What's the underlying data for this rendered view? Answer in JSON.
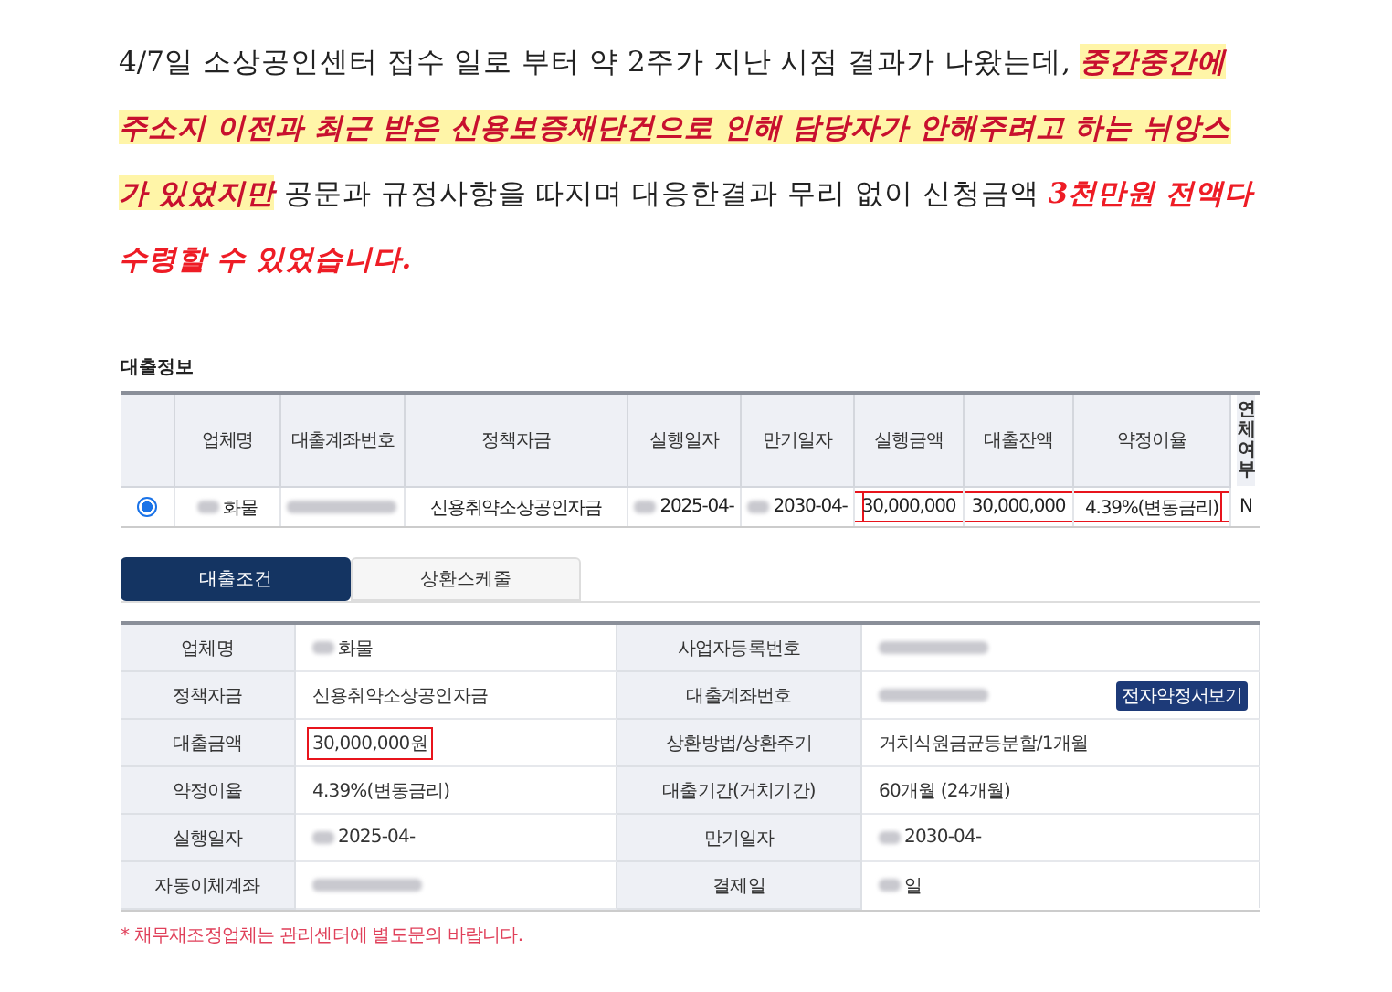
{
  "paragraph": [
    {
      "kind": "plain",
      "text": "4/7일 소상공인센터 접수 일로 부터 약 2주가 지난 시점 결과가 나왔는데, "
    },
    {
      "kind": "highlight",
      "text": "중간중간에 주소지 이전과 최근 받은 신용보증재단건으로 인해 담당자가 안해주려고 하는 뉘앙스 가 있었지만"
    },
    {
      "kind": "plain",
      "text": " 공문과 규정사항을 따지며 대응한결과 무리 없이 신청금액 "
    },
    {
      "kind": "emphasis",
      "text": "3천만원 전액다 수령할 수 있었습니다."
    }
  ],
  "loan_info": {
    "title": "대출정보",
    "columns": [
      "업체명",
      "대출계좌번호",
      "정책자금",
      "실행일자",
      "만기일자",
      "실행금액",
      "대출잔액",
      "약정이율",
      "연체여부"
    ],
    "rows": [
      {
        "selected": true,
        "cells": [
          {
            "text": "화물",
            "blurred": true,
            "framed": false
          },
          {
            "blurred": true,
            "framed": false
          },
          {
            "text": "신용취약소상공인자금",
            "blurred": false,
            "framed": false
          },
          {
            "text": "2025-04-",
            "blurred": true,
            "framed": false
          },
          {
            "text": "2030-04-",
            "blurred": true,
            "framed": false
          },
          {
            "text": "30,000,000",
            "blurred": false,
            "framed": true
          },
          {
            "text": "30,000,000",
            "blurred": false,
            "framed": true
          },
          {
            "text": "4.39%(변동금리)",
            "blurred": false,
            "framed": true
          },
          {
            "text": "N",
            "blurred": false,
            "framed": false
          }
        ]
      }
    ]
  },
  "tabs": [
    {
      "label": "대출조건",
      "selected": true
    },
    {
      "label": "상환스케줄",
      "selected": false
    }
  ],
  "details": [
    {
      "label": "업체명",
      "value": "화물",
      "blurred": true,
      "framed": false
    },
    {
      "label": "사업자등록번호",
      "blurred": true,
      "framed": false
    },
    {
      "label": "정책자금",
      "value": "신용취약소상공인자금",
      "blurred": false,
      "framed": false
    },
    {
      "label": "대출계좌번호",
      "blurred": true,
      "framed": false,
      "button": "전자약정서보기"
    },
    {
      "label": "대출금액",
      "value": "30,000,000원",
      "blurred": false,
      "framed": true
    },
    {
      "label": "상환방법/상환주기",
      "value": "거치식원금균등분할/1개월",
      "blurred": false,
      "framed": false
    },
    {
      "label": "약정이율",
      "value": "4.39%(변동금리)",
      "blurred": false,
      "framed": false
    },
    {
      "label": "대출기간(거치기간)",
      "value": "60개월 (24개월)",
      "blurred": false,
      "framed": false
    },
    {
      "label": "실행일자",
      "value": "2025-04-",
      "blurred": true,
      "framed": false
    },
    {
      "label": "만기일자",
      "value": "2030-04-",
      "blurred": true,
      "framed": false
    },
    {
      "label": "자동이체계좌",
      "blurred": true,
      "framed": false
    },
    {
      "label": "결제일",
      "value": "일",
      "blurred": true,
      "framed": false
    }
  ],
  "footnote": "* 채무재조정업체는 관리센터에 별도문의 바랍니다."
}
